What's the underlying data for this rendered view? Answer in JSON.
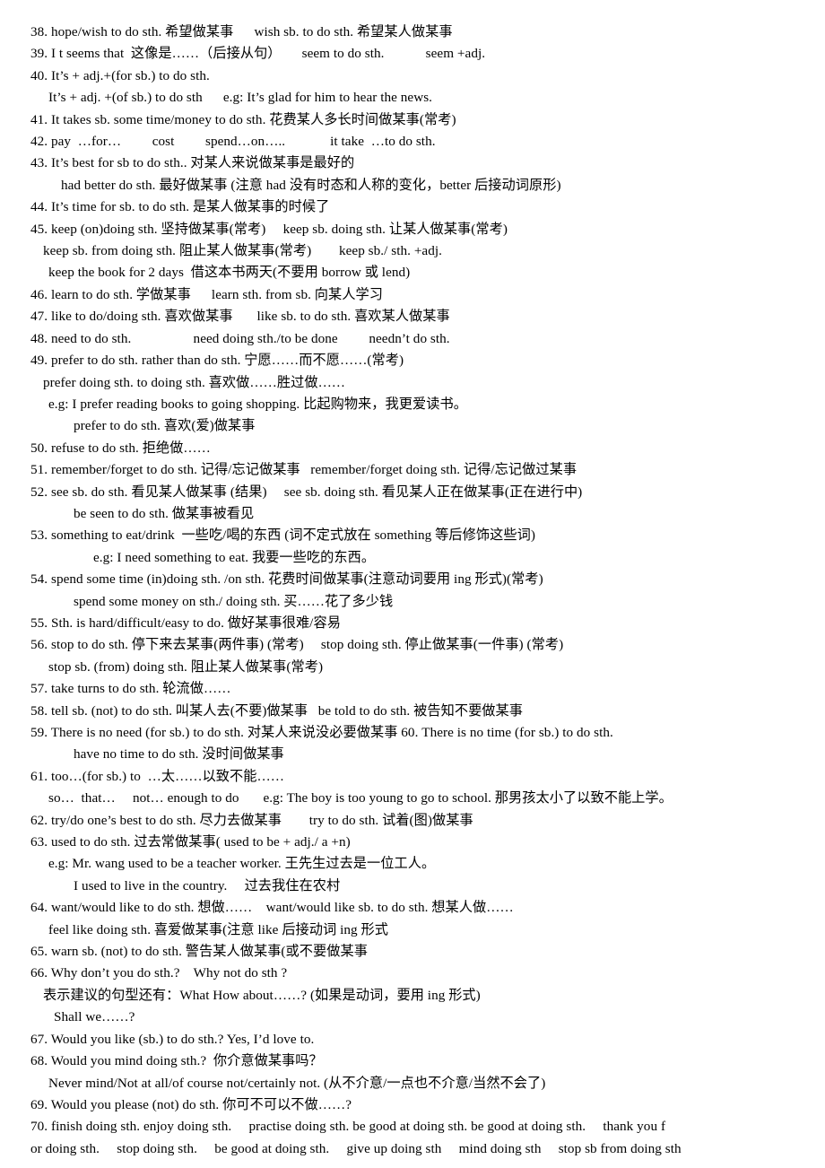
{
  "document": {
    "kind": "scanned-grammar-notes",
    "page_background": "#ffffff",
    "text_color": "#000000",
    "lines": [
      {
        "indent": 0,
        "text": "38. hope/wish to do sth. 希望做某事      wish sb. to do sth. 希望某人做某事"
      },
      {
        "indent": 0,
        "text": "39. I t seems that  这像是……（后接从句）      seem to do sth.            seem +adj."
      },
      {
        "indent": 0,
        "text": "40. It’s + adj.+(for sb.) to do sth."
      },
      {
        "indent": 2,
        "text": "It’s + adj. +(of sb.) to do sth      e.g: It’s glad for him to hear the news."
      },
      {
        "indent": 0,
        "text": "41. It takes sb. some time/money to do sth. 花费某人多长时间做某事(常考)"
      },
      {
        "indent": 0,
        "text": "42. pay  …for…         cost         spend…on…..             it take  …to do sth."
      },
      {
        "indent": 0,
        "text": "43. It’s best for sb to do sth.. 对某人来说做某事是最好的"
      },
      {
        "indent": 4,
        "text": "had better do sth. 最好做某事 (注意 had 没有时态和人称的变化，better 后接动词原形)"
      },
      {
        "indent": 0,
        "text": "44. It’s time for sb. to do sth. 是某人做某事的时候了"
      },
      {
        "indent": 0,
        "text": "45. keep (on)doing sth. 坚持做某事(常考)     keep sb. doing sth. 让某人做某事(常考)"
      },
      {
        "indent": 1,
        "text": "keep sb. from doing sth. 阻止某人做某事(常考)        keep sb./ sth. +adj."
      },
      {
        "indent": 2,
        "text": "keep the book for 2 days  借这本书两天(不要用 borrow 或 lend)"
      },
      {
        "indent": 0,
        "text": "46. learn to do sth. 学做某事      learn sth. from sb. 向某人学习"
      },
      {
        "indent": 0,
        "text": "47. like to do/doing sth. 喜欢做某事       like sb. to do sth. 喜欢某人做某事"
      },
      {
        "indent": 0,
        "text": "48. need to do sth.                  need doing sth./to be done         needn’t do sth."
      },
      {
        "indent": 0,
        "text": "49. prefer to do sth. rather than do sth. 宁愿……而不愿……(常考)"
      },
      {
        "indent": 1,
        "text": "prefer doing sth. to doing sth. 喜欢做……胜过做……"
      },
      {
        "indent": 2,
        "text": "e.g: I prefer reading books to going shopping. 比起购物来，我更爱读书。"
      },
      {
        "indent": 5,
        "text": "prefer to do sth. 喜欢(爱)做某事"
      },
      {
        "indent": 0,
        "text": "50. refuse to do sth. 拒绝做……"
      },
      {
        "indent": 0,
        "text": "51. remember/forget to do sth. 记得/忘记做某事   remember/forget doing sth. 记得/忘记做过某事"
      },
      {
        "indent": 0,
        "text": "52. see sb. do sth. 看见某人做某事 (结果)     see sb. doing sth. 看见某人正在做某事(正在进行中)"
      },
      {
        "indent": 5,
        "text": "be seen to do sth. 做某事被看见"
      },
      {
        "indent": 0,
        "text": "53. something to eat/drink  一些吃/喝的东西 (词不定式放在 something 等后修饰这些词)"
      },
      {
        "indent": 6,
        "text": "e.g: I need something to eat. 我要一些吃的东西。"
      },
      {
        "indent": 0,
        "text": "54. spend some time (in)doing sth. /on sth. 花费时间做某事(注意动词要用 ing 形式)(常考)"
      },
      {
        "indent": 5,
        "text": "spend some money on sth./ doing sth. 买……花了多少钱"
      },
      {
        "indent": 0,
        "text": "55. Sth. is hard/difficult/easy to do. 做好某事很难/容易"
      },
      {
        "indent": 0,
        "text": "56. stop to do sth. 停下来去某事(两件事) (常考)     stop doing sth. 停止做某事(一件事) (常考)"
      },
      {
        "indent": 2,
        "text": "stop sb. (from) doing sth. 阻止某人做某事(常考)"
      },
      {
        "indent": 0,
        "text": "57. take turns to do sth. 轮流做……"
      },
      {
        "indent": 0,
        "text": "58. tell sb. (not) to do sth. 叫某人去(不要)做某事   be told to do sth. 被告知不要做某事"
      },
      {
        "indent": 0,
        "text": "59. There is no need (for sb.) to do sth. 对某人来说没必要做某事 60. There is no time (for sb.) to do sth."
      },
      {
        "indent": 5,
        "text": "have no time to do sth. 没时间做某事"
      },
      {
        "indent": 0,
        "text": "61. too…(for sb.) to  …太……以致不能……"
      },
      {
        "indent": 2,
        "text": "so…  that…     not… enough to do       e.g: The boy is too young to go to school. 那男孩太小了以致不能上学。"
      },
      {
        "indent": 0,
        "text": "62. try/do one’s best to do sth. 尽力去做某事        try to do sth. 试着(图)做某事"
      },
      {
        "indent": 0,
        "text": "63. used to do sth. 过去常做某事( used to be + adj./ a +n)"
      },
      {
        "indent": 2,
        "text": "e.g: Mr. wang used to be a teacher worker. 王先生过去是一位工人。"
      },
      {
        "indent": 5,
        "text": "I used to live in the country.     过去我住在农村"
      },
      {
        "indent": 0,
        "text": "64. want/would like to do sth. 想做……    want/would like sb. to do sth. 想某人做……"
      },
      {
        "indent": 2,
        "text": "feel like doing sth. 喜爱做某事(注意 like 后接动词 ing 形式"
      },
      {
        "indent": 0,
        "text": "65. warn sb. (not) to do sth. 警告某人做某事(或不要做某事"
      },
      {
        "indent": 0,
        "text": "66. Why don’t you do sth.?    Why not do sth ?"
      },
      {
        "indent": 1,
        "text": "表示建议的句型还有：What How about……? (如果是动词，要用 ing 形式)"
      },
      {
        "indent": 3,
        "text": "Shall we……?"
      },
      {
        "indent": 0,
        "text": "67. Would you like (sb.) to do sth.? Yes, I’d love to."
      },
      {
        "indent": 0,
        "text": "68. Would you mind doing sth.?  你介意做某事吗？"
      },
      {
        "indent": 2,
        "text": "Never mind/Not at all/of course not/certainly not. (从不介意/一点也不介意/当然不会了)"
      },
      {
        "indent": 0,
        "text": "69. Would you please (not) do sth. 你可不可以不做……?"
      },
      {
        "indent": 0,
        "text": "70. finish doing sth. enjoy doing sth.     practise doing sth. be good at doing sth. be good at doing sth.     thank you f"
      },
      {
        "indent": 0,
        "text": "or doing sth.     stop doing sth.     be good at doing sth.     give up doing sth     mind doing sth     stop sb from doing sth"
      }
    ]
  }
}
